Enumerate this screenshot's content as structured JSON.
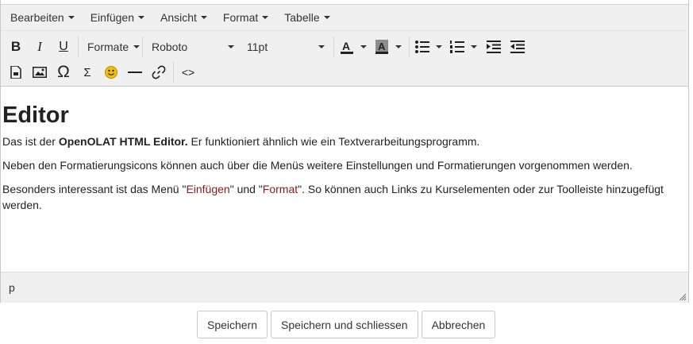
{
  "menubar": {
    "items": [
      {
        "label": "Bearbeiten"
      },
      {
        "label": "Einfügen"
      },
      {
        "label": "Ansicht"
      },
      {
        "label": "Format"
      },
      {
        "label": "Tabelle"
      }
    ]
  },
  "toolbar": {
    "bold": "B",
    "italic": "I",
    "underline": "U",
    "formats": "Formate",
    "font_family": "Roboto",
    "font_size": "11pt",
    "omega": "Ω",
    "sigma": "Σ",
    "code": "<>"
  },
  "content": {
    "heading": "Editor",
    "p1_pre": "Das ist der ",
    "p1_bold": "OpenOLAT HTML Editor.",
    "p1_post": " Er funktioniert ähnlich wie  ein Textverarbeitungsprogramm.",
    "p2": "Neben den Formatierungsicons können auch über die Menüs weitere Einstellungen und Formatierungen vorgenommen werden.",
    "p3_a": "Besonders interessant ist das Menü \"",
    "p3_link1": "Einfügen",
    "p3_b": "\" und \"",
    "p3_link2": "Format",
    "p3_c": "\". So können auch Links zu Kurselementen oder zur Toolleiste hinzugefügt werden."
  },
  "statusbar": {
    "path": "p"
  },
  "actions": {
    "save": "Speichern",
    "save_close": "Speichern und schliessen",
    "cancel": "Abbrechen"
  },
  "colors": {
    "toolbar_bg": "#f0f0f0",
    "link_color": "#8b1a1a",
    "smiley": "#f2c200"
  }
}
